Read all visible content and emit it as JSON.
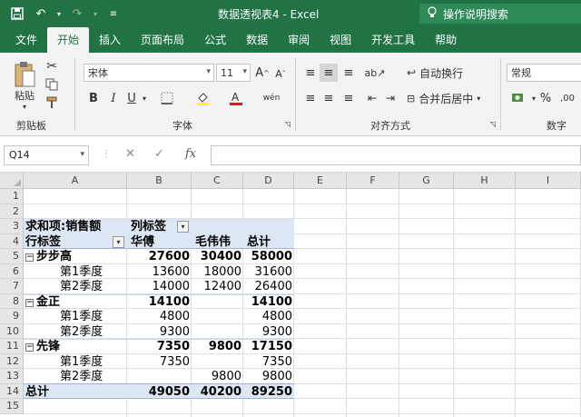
{
  "app": {
    "title": "数据透视表4  -  Excel",
    "tellme": "操作说明搜索"
  },
  "tabs": [
    "文件",
    "开始",
    "插入",
    "页面布局",
    "公式",
    "数据",
    "审阅",
    "视图",
    "开发工具",
    "帮助"
  ],
  "ribbon": {
    "clipboard": {
      "paste": "粘贴",
      "label": "剪贴板"
    },
    "font": {
      "name": "宋体",
      "size": "11",
      "bold": "B",
      "italic": "I",
      "underline": "U",
      "grow": "A",
      "shrink": "A",
      "label": "字体"
    },
    "alignment": {
      "wrap": "自动换行",
      "merge": "合并后居中",
      "label": "对齐方式"
    },
    "number": {
      "format": "常规",
      "percent": "%",
      "label": "数字"
    }
  },
  "formula_bar": {
    "name_box": "Q14",
    "fx": "fx",
    "value": ""
  },
  "sheet": {
    "columns": [
      "A",
      "B",
      "C",
      "D",
      "E",
      "F",
      "G",
      "H",
      "I"
    ],
    "rows": [
      "1",
      "2",
      "3",
      "4",
      "5",
      "6",
      "7",
      "8",
      "9",
      "10",
      "11",
      "12",
      "13",
      "14",
      "15"
    ],
    "pivot": {
      "values_label": "求和项:销售额",
      "col_label": "列标签",
      "row_label": "行标签",
      "col_items": [
        "华傅",
        "毛伟伟",
        "总计"
      ],
      "groups": [
        {
          "name": "步步高",
          "vals": [
            "27600",
            "30400",
            "58000"
          ],
          "children": [
            {
              "name": "第1季度",
              "vals": [
                "13600",
                "18000",
                "31600"
              ]
            },
            {
              "name": "第2季度",
              "vals": [
                "14000",
                "12400",
                "26400"
              ]
            }
          ]
        },
        {
          "name": "金正",
          "vals": [
            "14100",
            "",
            "14100"
          ],
          "children": [
            {
              "name": "第1季度",
              "vals": [
                "4800",
                "",
                "4800"
              ]
            },
            {
              "name": "第2季度",
              "vals": [
                "9300",
                "",
                "9300"
              ]
            }
          ]
        },
        {
          "name": "先锋",
          "vals": [
            "7350",
            "9800",
            "17150"
          ],
          "children": [
            {
              "name": "第1季度",
              "vals": [
                "7350",
                "",
                "7350"
              ]
            },
            {
              "name": "第2季度",
              "vals": [
                "",
                "9800",
                "9800"
              ]
            }
          ]
        }
      ],
      "total": {
        "name": "总计",
        "vals": [
          "49050",
          "40200",
          "89250"
        ]
      }
    }
  },
  "colors": {
    "accent": "#217346",
    "pivot_header": "#dde7f4"
  }
}
